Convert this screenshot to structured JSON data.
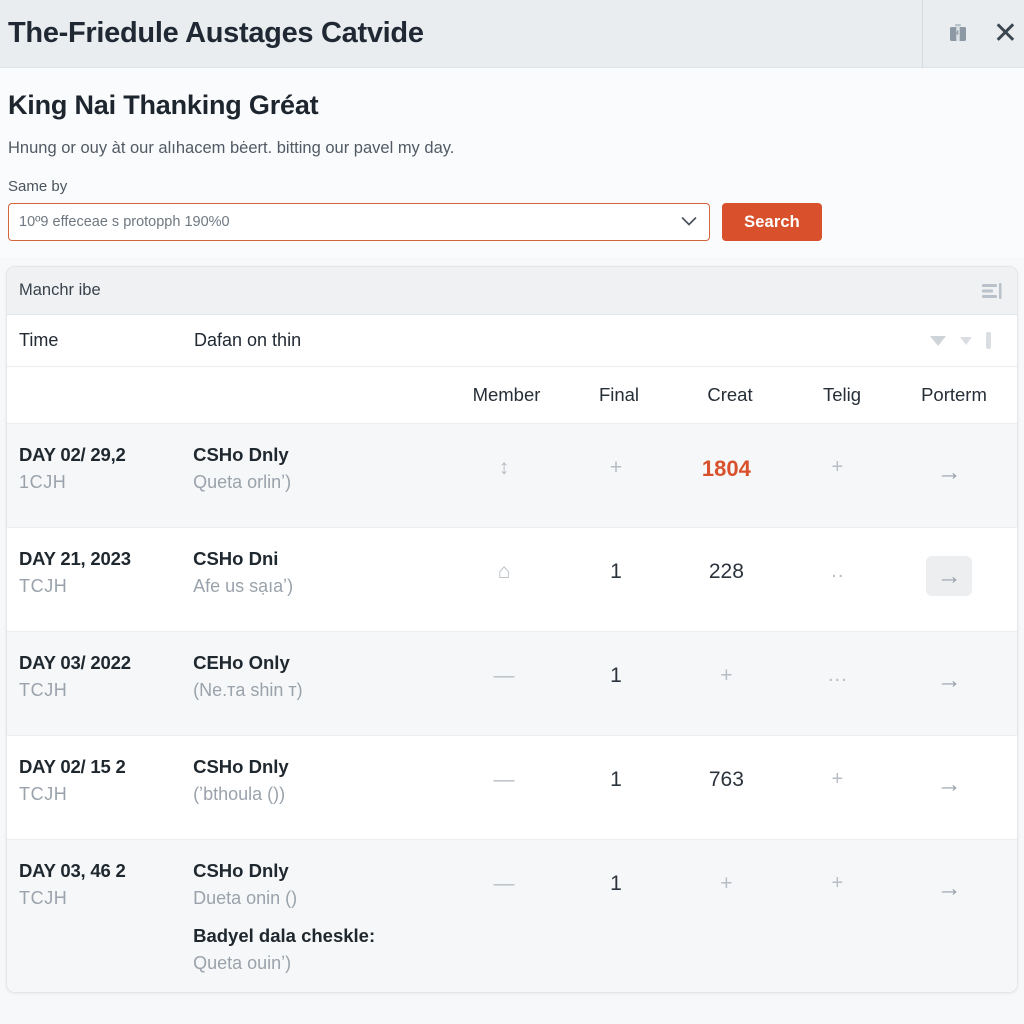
{
  "titlebar": {
    "title": "The-Friedule Austages Catvide",
    "device_icon": "device-icon",
    "close_icon": "✕"
  },
  "header": {
    "heading": "King Nai Thanking Gréat",
    "subtitle": "Hnung or ouy àt our alıhacem bėert. bitting our pavel my day.",
    "field_label": "Same by",
    "select_value": "10º9 effeceae s protopph 190%0",
    "chevron": "⌄",
    "search_button": "Search"
  },
  "results": {
    "toolbar_title": "Manchr ibe",
    "toolbar_icon": "list-sort-icon",
    "head": {
      "time": "Time",
      "description": "Dafan on thin"
    },
    "columns": [
      "Member",
      "Final",
      "Creat",
      "Telig",
      "Porterm"
    ],
    "rows": [
      {
        "time_main": "DAY 02/ 29,2",
        "time_sub": "1CJH",
        "desc_main": "CSHo Dnly",
        "desc_sub": "Queta orlinʼ)",
        "member": "↕",
        "final": "+",
        "creat": "1804",
        "telig": "+",
        "porterm": "→",
        "creat_accent": true,
        "arrow_active": false,
        "shade": "alt"
      },
      {
        "time_main": "DAY 21, 2023",
        "time_sub": "TCJH",
        "desc_main": "CSHo Dni",
        "desc_sub": "Afe us sạıaʼ)",
        "member": "⌂",
        "final": "1",
        "creat": "228",
        "telig": "..",
        "porterm": "→",
        "creat_accent": false,
        "arrow_active": true,
        "shade": "plain"
      },
      {
        "time_main": "DAY 03/ 2022",
        "time_sub": "TCJH",
        "desc_main": "CEHo Only",
        "desc_sub": "(Ne.тa shin т)",
        "member": "—",
        "final": "1",
        "creat": "+",
        "telig": "...",
        "porterm": "→",
        "creat_accent": false,
        "arrow_active": false,
        "shade": "alt"
      },
      {
        "time_main": "DAY 02/ 15 2",
        "time_sub": "TCJH",
        "desc_main": "CSHo Dnly",
        "desc_sub": "(ʼbthoula ())",
        "member": "—",
        "final": "1",
        "creat": "763",
        "telig": "+",
        "porterm": "→",
        "creat_accent": false,
        "arrow_active": false,
        "shade": "plain"
      },
      {
        "time_main": "DAY 03, 46 2",
        "time_sub": "TCJH",
        "desc_main": "CSHo Dnly",
        "desc_sub": "Dueta onin ()",
        "desc_extra_title": "Badyel dala cheskle:",
        "desc_extra_sub": "Queta ouinʼ)",
        "member": "—",
        "final": "1",
        "creat": "+",
        "telig": "+",
        "porterm": "→",
        "creat_accent": false,
        "arrow_active": false,
        "shade": "alt"
      }
    ]
  },
  "colors": {
    "accent": "#d9512c",
    "titlebar_bg": "#e9edf0",
    "page_bg": "#f7f8fa"
  }
}
